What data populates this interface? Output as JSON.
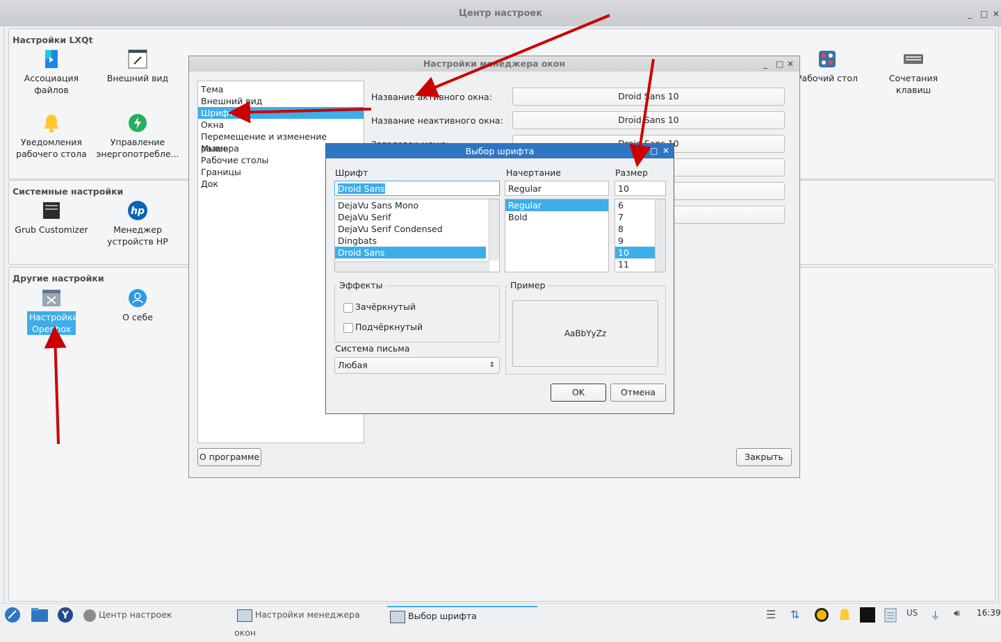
{
  "main_window": {
    "title": "Центр настроек",
    "controls": [
      "_",
      "□",
      "✕"
    ]
  },
  "groups": {
    "lxqt": {
      "title": "Настройки LXQt",
      "items": [
        {
          "label": "Ассоциация файлов",
          "icon": "file-association-icon"
        },
        {
          "label": "Внешний вид",
          "icon": "appearance-icon"
        },
        {
          "label": "Рабочий стол",
          "icon": "desktop-icon"
        },
        {
          "label": "Сочетания клавиш",
          "icon": "keyboard-icon"
        },
        {
          "label": "Уведомления рабочего стола",
          "icon": "bell-icon"
        },
        {
          "label": "Управление энергопотребле...",
          "icon": "power-icon"
        }
      ]
    },
    "system": {
      "title": "Системные настройки",
      "items": [
        {
          "label": "Grub Customizer",
          "icon": "grub-icon"
        },
        {
          "label": "Менеджер устройств HP",
          "icon": "hp-icon"
        }
      ]
    },
    "other": {
      "title": "Другие настройки",
      "items": [
        {
          "label": "Настройки Openbox",
          "icon": "openbox-icon"
        },
        {
          "label": "О себе",
          "icon": "user-icon"
        }
      ]
    }
  },
  "ob_window": {
    "title": "Настройки менеджера окон",
    "sections": [
      "Тема",
      "Внешний вид",
      "Шрифт",
      "Окна",
      "Перемещение и изменение размера",
      "Мышь",
      "Рабочие столы",
      "Границы",
      "Док"
    ],
    "selected_section": "Шрифт",
    "rows": [
      {
        "label": "Название активного окна:",
        "value": "Droid Sans 10"
      },
      {
        "label": "Название неактивного окна:",
        "value": "Droid Sans 10"
      },
      {
        "label": "Заголовок меню:",
        "value": "Droid Sans 10"
      }
    ],
    "about_button": "О программе",
    "close_button": "Закрыть"
  },
  "font_dialog": {
    "title": "Выбор шрифта",
    "family_label": "Шрифт",
    "style_label": "Начертание",
    "size_label": "Размер",
    "family_value": "Droid Sans",
    "style_value": "Regular",
    "size_value": "10",
    "families": [
      "DejaVu Sans Mono",
      "DejaVu Serif",
      "DejaVu Serif Condensed",
      "Dingbats",
      "Droid Sans"
    ],
    "styles": [
      "Regular",
      "Bold"
    ],
    "sizes": [
      "6",
      "7",
      "8",
      "9",
      "10",
      "11"
    ],
    "effects_label": "Эффекты",
    "strikeout_label": "Зачёркнутый",
    "underline_label": "Подчёркнутый",
    "writing_system_label": "Система письма",
    "writing_system_value": "Любая",
    "sample_label": "Пример",
    "sample_text": "AaBbYyZz",
    "ok_button": "OK",
    "cancel_button": "Отмена"
  },
  "taskbar": {
    "tasks": [
      "Центр настроек",
      "Настройки менеджера окон",
      "Выбор шрифта"
    ],
    "keyboard_layout": "US",
    "clock": "16:39"
  },
  "colors": {
    "accent": "#3daee9",
    "dialog_title": "#2f75c2",
    "annotation_arrow": "#cc0000"
  }
}
